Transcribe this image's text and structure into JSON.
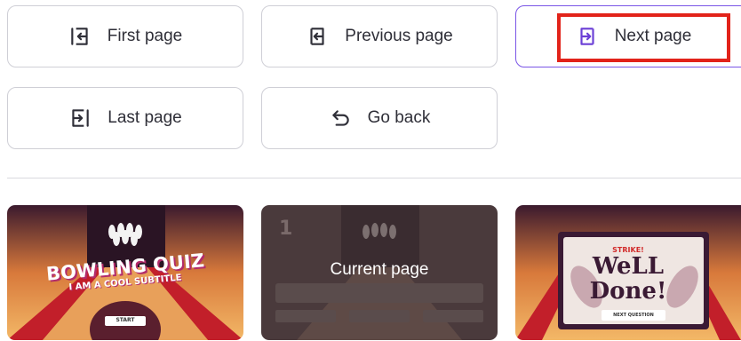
{
  "navigation": {
    "first_page": {
      "label": "First page",
      "icon": "first-page-icon"
    },
    "previous_page": {
      "label": "Previous page",
      "icon": "previous-page-icon"
    },
    "next_page": {
      "label": "Next page",
      "icon": "next-page-icon",
      "selected": true
    },
    "last_page": {
      "label": "Last page",
      "icon": "last-page-icon"
    },
    "go_back": {
      "label": "Go back",
      "icon": "go-back-icon"
    }
  },
  "thumbnails": [
    {
      "title": "BOWLING QUIZ",
      "subtitle": "I AM A COOL SUBTITLE",
      "button": "START"
    },
    {
      "number": "1",
      "overlay_label": "Current page"
    },
    {
      "strike": "STRIKE!",
      "message_line1": "WeLL",
      "message_line2": "Done!",
      "button": "NEXT QUESTION"
    }
  ],
  "colors": {
    "accent": "#7a55e6",
    "highlight": "#e2231a"
  }
}
